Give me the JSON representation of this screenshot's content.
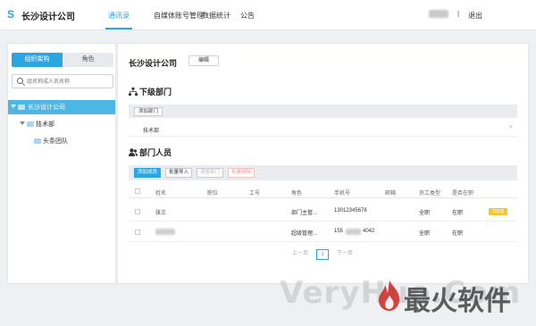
{
  "topbar": {
    "logo_glyph": "S",
    "company": "长沙设计公司",
    "nav": [
      {
        "label": "通讯录",
        "active": true
      },
      {
        "label": "自媒体账号管理",
        "active": false
      },
      {
        "label": "数据统计",
        "active": false
      },
      {
        "label": "公告",
        "active": false
      }
    ],
    "separator": "|",
    "logout": "退出",
    "accent_color": "#2aa6e0"
  },
  "sidebar": {
    "tabs": [
      "组织架构",
      "角色"
    ],
    "search_placeholder": "组名称成人员名称",
    "tree": [
      {
        "label": "长沙设计公司",
        "selected": true,
        "icon": "folder-icon"
      },
      {
        "label": "技术部",
        "selected": false,
        "icon": "folder-icon"
      },
      {
        "label": "头条团队",
        "selected": false,
        "icon": "folder-icon"
      }
    ]
  },
  "main": {
    "title": "长沙设计公司",
    "edit_label": "编辑",
    "sub_dept": {
      "title": "下级部门",
      "add_label": "添加部门",
      "rows": [
        "技术部"
      ],
      "row_arrow": ">"
    },
    "members": {
      "title": "部门人员",
      "toolbar": [
        "添加成员",
        "批量导入",
        "调整部门",
        "批量删除"
      ],
      "columns": [
        "姓名",
        "职位",
        "工号",
        "角色",
        "手机号",
        "邮箱",
        "员工类型",
        "是否在职"
      ],
      "rows": [
        {
          "name": "张三",
          "position": "",
          "id": "",
          "role": "部门主管...",
          "phone": "13012345678",
          "email": "",
          "type": "全职",
          "status": "在职",
          "badge": "次管理"
        },
        {
          "name": "",
          "position": "",
          "id": "",
          "role": "超级管理...",
          "phone_prefix": "155",
          "phone_suffix": "4042",
          "email": "",
          "type": "全职",
          "status": "在职",
          "badge": ""
        }
      ]
    },
    "pager": {
      "prev": "上一页",
      "page": "1",
      "next": "下一页"
    }
  },
  "watermark": {
    "text": "VeryHuo.Com",
    "brand": "最火软件"
  }
}
